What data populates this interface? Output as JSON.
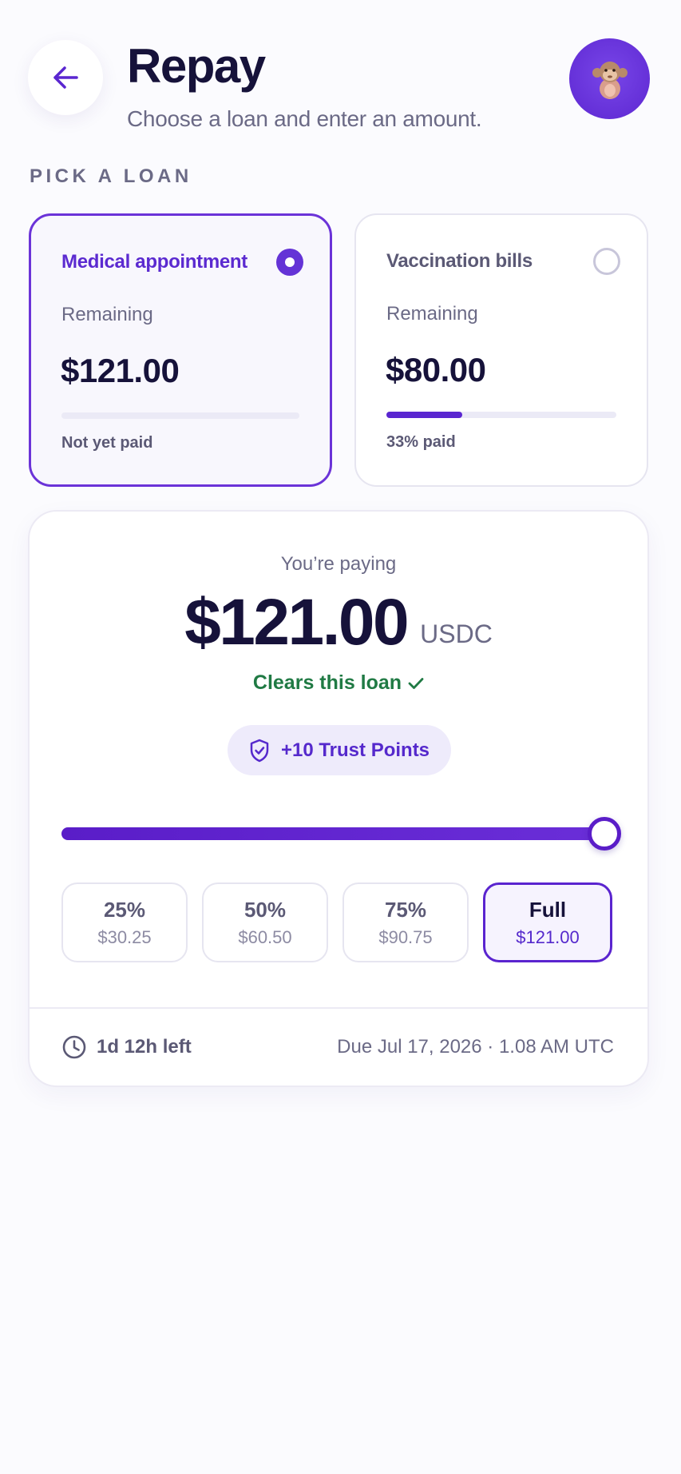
{
  "header": {
    "title": "Repay",
    "subtitle": "Choose a loan and enter an amount.",
    "back_icon": "arrow-left-icon",
    "avatar_icon": "monkey-avatar-icon"
  },
  "section_label": "PICK A LOAN",
  "loans": [
    {
      "name": "Medical appointment",
      "remaining_label": "Remaining",
      "amount": "$121.00",
      "paid_fraction": 0,
      "status": "Not yet paid",
      "selected": true
    },
    {
      "name": "Vaccination bills",
      "remaining_label": "Remaining",
      "amount": "$80.00",
      "paid_fraction": 0.33,
      "status": "33% paid",
      "selected": false
    }
  ],
  "payment": {
    "label": "You’re paying",
    "amount": "$121.00",
    "currency": "USDC",
    "clears_text": "Clears this loan",
    "trust_points": "+10 Trust Points",
    "slider_fraction": 1.0,
    "presets": [
      {
        "label": "25%",
        "amount": "$30.25",
        "active": false
      },
      {
        "label": "50%",
        "amount": "$60.50",
        "active": false
      },
      {
        "label": "75%",
        "amount": "$90.75",
        "active": false
      },
      {
        "label": "Full",
        "amount": "$121.00",
        "active": true
      }
    ],
    "time_left": "1d 12h left",
    "due": "Due Jul 17, 2026 · 1.08 AM UTC"
  },
  "colors": {
    "accent": "#5a24cf",
    "success": "#207a44",
    "text_primary": "#16123a",
    "text_muted": "#6b6a86"
  }
}
